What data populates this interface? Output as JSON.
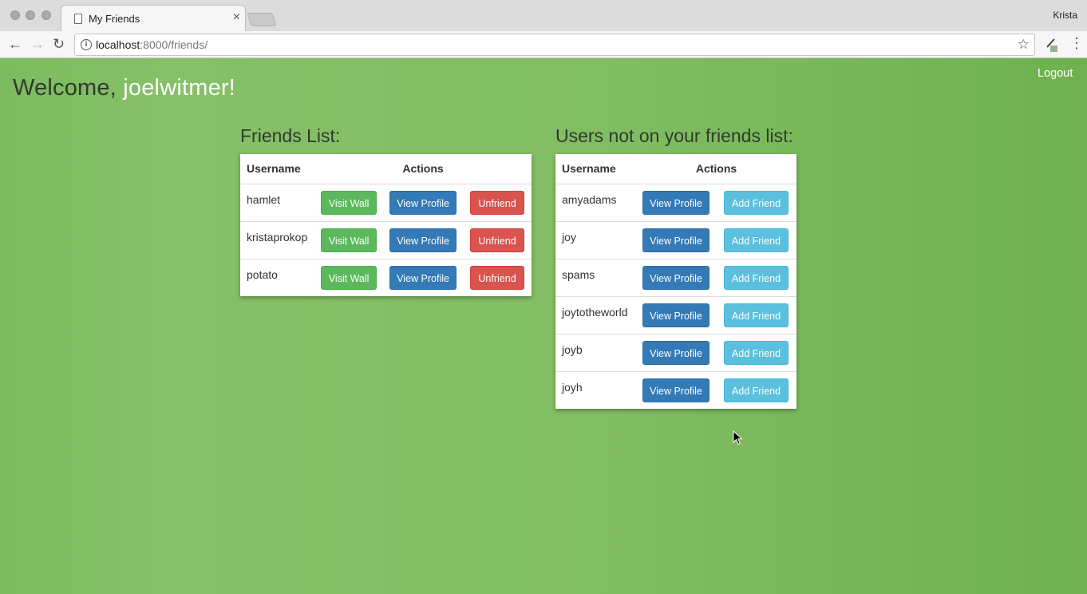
{
  "browser": {
    "tab_title": "My Friends",
    "tab_close": "×",
    "profile_name": "Krista",
    "url_host": "localhost",
    "url_path": ":8000/friends/",
    "info_icon": "i"
  },
  "header": {
    "logout_label": "Logout",
    "welcome_prefix": "Welcome, ",
    "username": "joelwitmer!"
  },
  "friends": {
    "title": "Friends List:",
    "col_username": "Username",
    "col_actions": "Actions",
    "rows": [
      {
        "username": "hamlet",
        "visit": "Visit Wall",
        "profile": "View Profile",
        "unfriend": "Unfriend"
      },
      {
        "username": "kristaprokop",
        "visit": "Visit Wall",
        "profile": "View Profile",
        "unfriend": "Unfriend"
      },
      {
        "username": "potato",
        "visit": "Visit Wall",
        "profile": "View Profile",
        "unfriend": "Unfriend"
      }
    ]
  },
  "others": {
    "title": "Users not on your friends list:",
    "col_username": "Username",
    "col_actions": "Actions",
    "rows": [
      {
        "username": "amyadams",
        "profile": "View Profile",
        "add": "Add Friend"
      },
      {
        "username": "joy",
        "profile": "View Profile",
        "add": "Add Friend"
      },
      {
        "username": "spams",
        "profile": "View Profile",
        "add": "Add Friend"
      },
      {
        "username": "joytotheworld",
        "profile": "View Profile",
        "add": "Add Friend"
      },
      {
        "username": "joyb",
        "profile": "View Profile",
        "add": "Add Friend"
      },
      {
        "username": "joyh",
        "profile": "View Profile",
        "add": "Add Friend"
      }
    ]
  },
  "colors": {
    "visit_button": "#5cb85c",
    "profile_button": "#337ab7",
    "unfriend_button": "#d9534f",
    "add_button": "#5bc0de",
    "page_background": "#7cbb5f"
  }
}
